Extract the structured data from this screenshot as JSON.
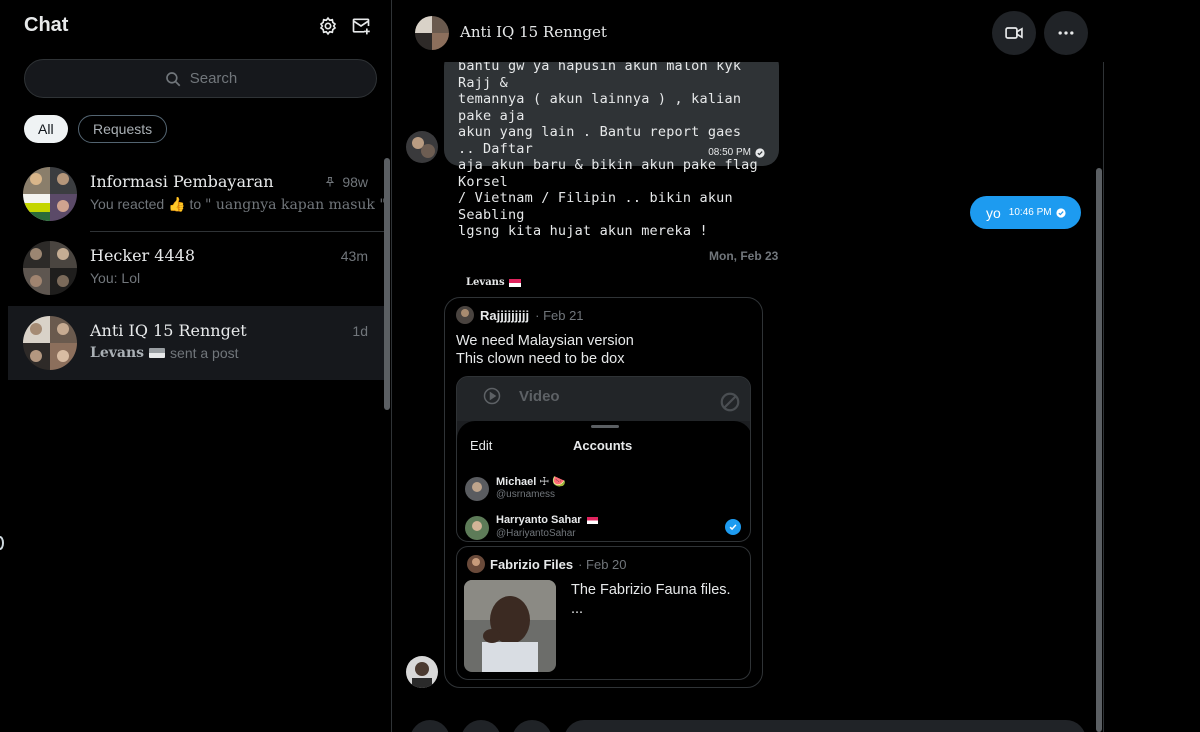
{
  "sidebar": {
    "title": "Chat",
    "settings_icon": "gear-icon",
    "compose_icon": "new-message-icon",
    "search": {
      "placeholder": "Search"
    },
    "filters": [
      {
        "label": "All",
        "selected": true
      },
      {
        "label": "Requests",
        "selected": false
      }
    ],
    "conversations": [
      {
        "name": "Informasi Pembayaran",
        "time": "98w",
        "pinned": true,
        "preview_prefix": "You reacted",
        "preview_emoji": "👍",
        "preview_to": "to",
        "preview_quote": "\" uangnya kapan masuk \""
      },
      {
        "name": "Hecker 4448",
        "time": "43m",
        "preview": "You: Lol"
      },
      {
        "name": "Anti IQ 15 Rennget",
        "time": "1d",
        "active": true,
        "preview_sender": "Levans",
        "preview_text": "sent a post"
      }
    ]
  },
  "chat": {
    "title": "Anti IQ 15 Rennget",
    "actions": {
      "video_icon": "video-call-icon",
      "more_icon": "more-icon"
    },
    "messages": {
      "incoming_text": "bantu gw ya hapusin akun malon kyk Rajj &\ntemannya ( akun lainnya ) , kalian pake aja\nakun yang lain . Bantu report gaes .. Daftar\naja akun baru & bikin akun pake flag Korsel\n/ Vietnam / Filipin .. bikin akun Seabling\nlgsng kita hujat akun mereka !",
      "incoming_time": "08:50 PM",
      "outgoing_text": "yo",
      "outgoing_time": "10:46 PM",
      "date_separator": "Mon, Feb 23",
      "shared_sender": "Levans"
    },
    "post": {
      "author": "Rajjjjjjjjj",
      "date": "· Feb 21",
      "text": "We need Malaysian version\nThis clown need to be dox",
      "video_label": "Video",
      "sheet": {
        "edit": "Edit",
        "title": "Accounts",
        "accounts": [
          {
            "name": "Michael ☩ 🍉",
            "handle": "@usrnamess",
            "selected": false
          },
          {
            "name": "Harryanto Sahar",
            "handle": "@HariyantoSahar",
            "selected": true
          }
        ]
      },
      "quote": {
        "author": "Fabrizio Files",
        "date": "· Feb 20",
        "text": "The Fabrizio Fauna files.\n..."
      }
    }
  },
  "colors": {
    "accent": "#1d9bf0",
    "background": "#000000",
    "bubble_in": "#2f3336",
    "muted": "#71767b"
  }
}
